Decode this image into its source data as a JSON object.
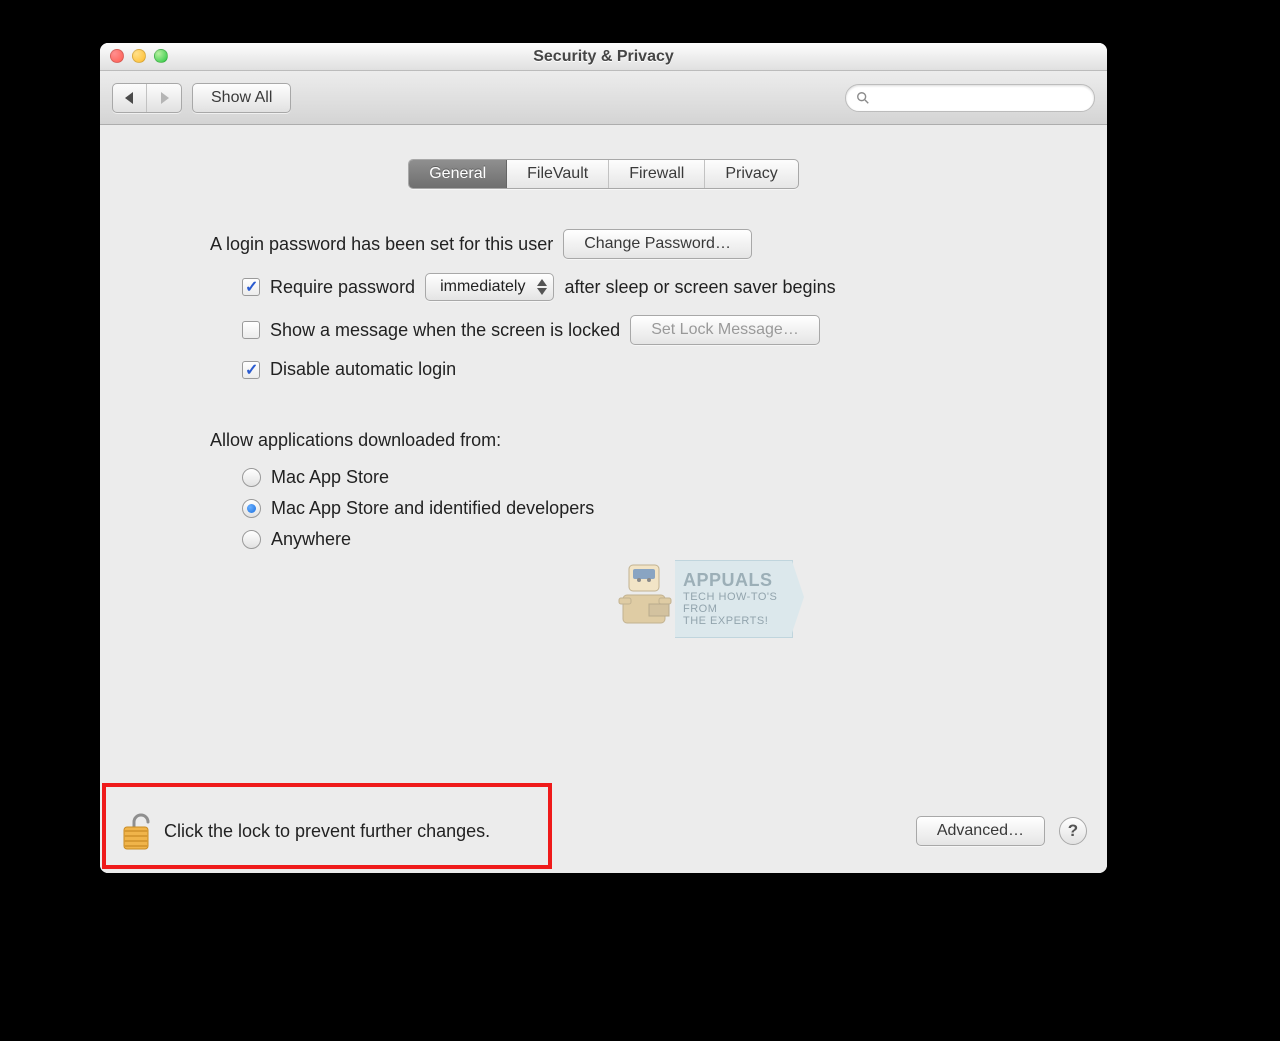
{
  "window": {
    "title": "Security & Privacy"
  },
  "toolbar": {
    "show_all_label": "Show All",
    "search_placeholder": ""
  },
  "tabs": {
    "general": "General",
    "filevault": "FileVault",
    "firewall": "Firewall",
    "privacy": "Privacy"
  },
  "main": {
    "login_password_text": "A login password has been set for this user",
    "change_password_label": "Change Password…",
    "require_password_label": "Require password",
    "require_password_delay": "immediately",
    "require_password_suffix": "after sleep or screen saver begins",
    "show_message_label": "Show a message when the screen is locked",
    "set_lock_message_label": "Set Lock Message…",
    "disable_auto_login_label": "Disable automatic login",
    "allow_apps_title": "Allow applications downloaded from:",
    "radio_options": {
      "mas": "Mac App Store",
      "mas_id": "Mac App Store and identified developers",
      "anywhere": "Anywhere"
    }
  },
  "footer": {
    "lock_text": "Click the lock to prevent further changes.",
    "advanced_label": "Advanced…",
    "help_label": "?"
  },
  "watermark": {
    "brand": "APPUALS",
    "tagline1": "TECH HOW-TO'S FROM",
    "tagline2": "THE EXPERTS!"
  }
}
